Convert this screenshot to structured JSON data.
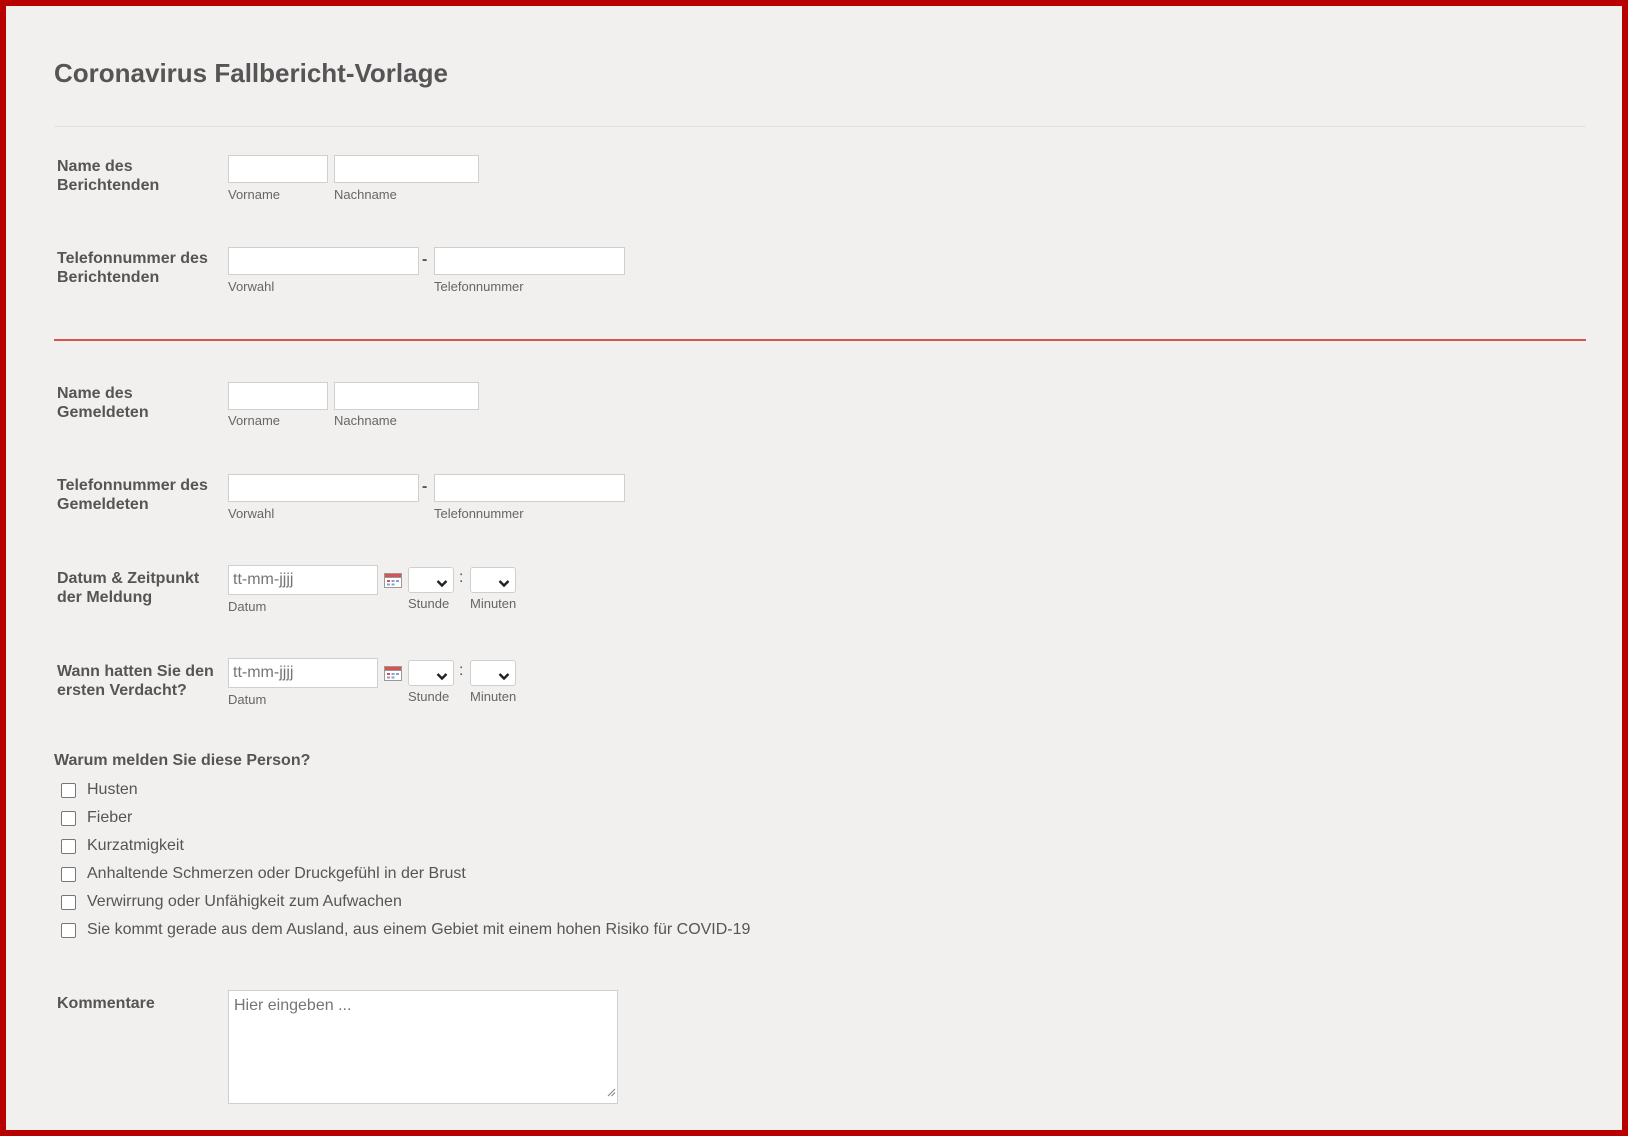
{
  "form": {
    "title": "Coronavirus Fallbericht-Vorlage",
    "reporter_name": {
      "label": "Name des Berichtenden",
      "first_name_sublabel": "Vorname",
      "last_name_sublabel": "Nachname",
      "first_name_value": "",
      "last_name_value": ""
    },
    "reporter_phone": {
      "label": "Telefonnummer des Berichtenden",
      "area_code_sublabel": "Vorwahl",
      "number_sublabel": "Telefonnummer",
      "separator": "-",
      "area_code_value": "",
      "number_value": ""
    },
    "reported_name": {
      "label": "Name des Gemeldeten",
      "first_name_sublabel": "Vorname",
      "last_name_sublabel": "Nachname",
      "first_name_value": "",
      "last_name_value": ""
    },
    "reported_phone": {
      "label": "Telefonnummer des Gemeldeten",
      "area_code_sublabel": "Vorwahl",
      "number_sublabel": "Telefonnummer",
      "separator": "-",
      "area_code_value": "",
      "number_value": ""
    },
    "report_datetime": {
      "label": "Datum & Zeitpunkt der Meldung",
      "date_placeholder": "tt-mm-jjjj",
      "date_sublabel": "Datum",
      "hour_sublabel": "Stunde",
      "minute_sublabel": "Minuten",
      "time_separator": ":",
      "hour_value": "",
      "minute_value": ""
    },
    "suspicion_datetime": {
      "label": "Wann hatten Sie den ersten Verdacht?",
      "date_placeholder": "tt-mm-jjjj",
      "date_sublabel": "Datum",
      "hour_sublabel": "Stunde",
      "minute_sublabel": "Minuten",
      "time_separator": ":",
      "hour_value": "",
      "minute_value": ""
    },
    "reasons": {
      "question": "Warum melden Sie diese Person?",
      "options": [
        {
          "label": "Husten",
          "checked": false
        },
        {
          "label": "Fieber",
          "checked": false
        },
        {
          "label": "Kurzatmigkeit",
          "checked": false
        },
        {
          "label": "Anhaltende Schmerzen oder Druckgefühl in der Brust",
          "checked": false
        },
        {
          "label": "Verwirrung oder Unfähigkeit zum Aufwachen",
          "checked": false
        },
        {
          "label": "Sie kommt gerade aus dem Ausland, aus einem Gebiet mit einem hohen Risiko für COVID-19",
          "checked": false
        }
      ]
    },
    "comments": {
      "label": "Kommentare",
      "placeholder": "Hier eingeben ..."
    }
  },
  "icons": {
    "calendar": "calendar-icon",
    "chevron": "chevron-down-icon",
    "resize": "resize-handle-icon"
  },
  "colors": {
    "frame_border": "#b80000",
    "background": "#f2efef",
    "divider_red": "#d9534f",
    "text": "#555555"
  }
}
